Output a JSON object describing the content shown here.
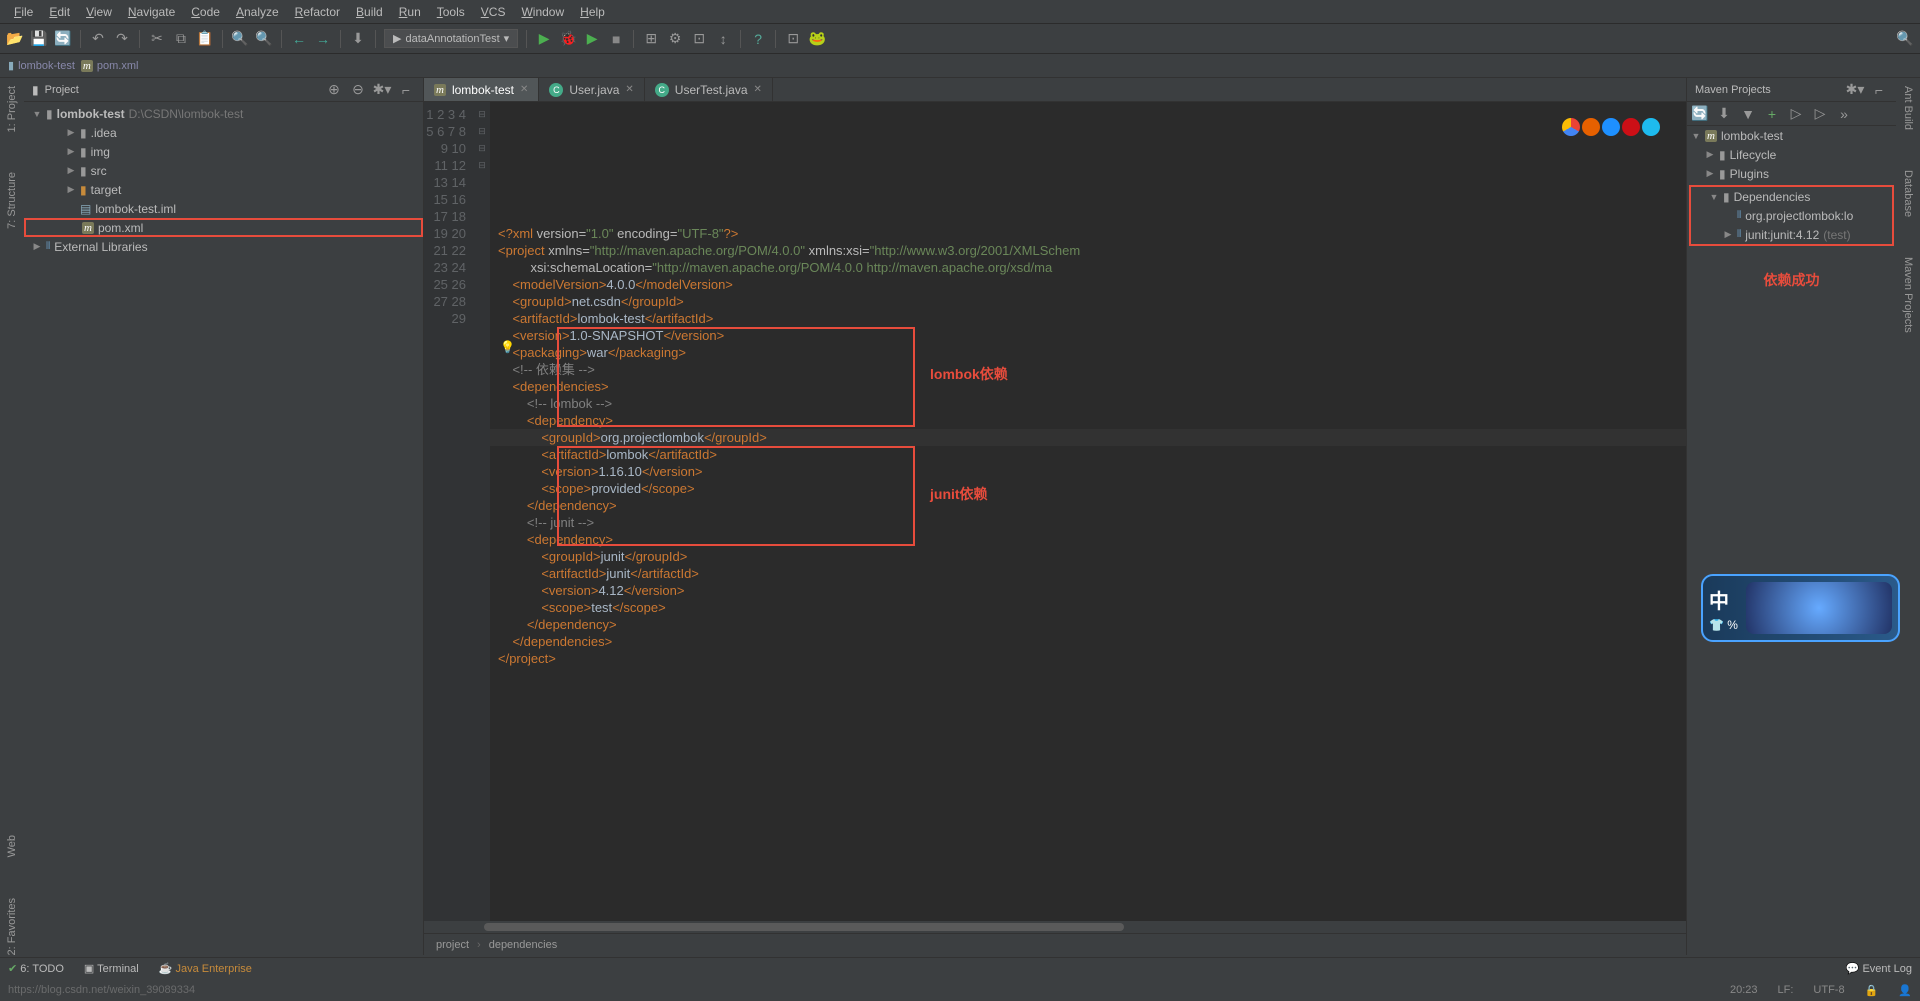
{
  "menu": [
    "File",
    "Edit",
    "View",
    "Navigate",
    "Code",
    "Analyze",
    "Refactor",
    "Build",
    "Run",
    "Tools",
    "VCS",
    "Window",
    "Help"
  ],
  "runConfig": "dataAnnotationTest",
  "nav": {
    "project": "lombok-test",
    "file": "pom.xml"
  },
  "projectPanel": {
    "title": "Project",
    "root": "lombok-test",
    "rootPath": "D:\\CSDN\\lombok-test",
    "folders": [
      ".idea",
      "img",
      "src",
      "target"
    ],
    "files": [
      "lombok-test.iml",
      "pom.xml"
    ],
    "extLib": "External Libraries"
  },
  "tabs": [
    {
      "name": "lombok-test",
      "icon": "m",
      "active": true
    },
    {
      "name": "User.java",
      "icon": "c",
      "active": false
    },
    {
      "name": "UserTest.java",
      "icon": "c",
      "active": false
    }
  ],
  "code": {
    "lines": 29,
    "content": [
      {
        "n": 1,
        "html": "<span class='tag'>&lt;?xml</span> <span class='attr'>version=</span><span class='str'>\"1.0\"</span> <span class='attr'>encoding=</span><span class='str'>\"UTF-8\"</span><span class='tag'>?&gt;</span>"
      },
      {
        "n": 2,
        "html": ""
      },
      {
        "n": 3,
        "html": "<span class='tag'>&lt;project</span> <span class='attr'>xmlns=</span><span class='str'>\"http://maven.apache.org/POM/4.0.0\"</span> <span class='attr'>xmlns:xsi=</span><span class='str'>\"http://www.w3.org/2001/XMLSchem</span>"
      },
      {
        "n": 4,
        "html": "         <span class='attr'>xsi:schemaLocation=</span><span class='str'>\"http://maven.apache.org/POM/4.0.0 http://maven.apache.org/xsd/ma</span>"
      },
      {
        "n": 5,
        "html": "    <span class='tag'>&lt;modelVersion&gt;</span><span class='txt'>4.0.0</span><span class='tag'>&lt;/modelVersion&gt;</span>"
      },
      {
        "n": 6,
        "html": "    <span class='tag'>&lt;groupId&gt;</span><span class='txt'>net.csdn</span><span class='tag'>&lt;/groupId&gt;</span>"
      },
      {
        "n": 7,
        "html": "    <span class='tag'>&lt;artifactId&gt;</span><span class='txt'>lombok-test</span><span class='tag'>&lt;/artifactId&gt;</span>"
      },
      {
        "n": 8,
        "html": "    <span class='tag'>&lt;version&gt;</span><span class='txt'>1.0-SNAPSHOT</span><span class='tag'>&lt;/version&gt;</span>"
      },
      {
        "n": 9,
        "html": "    <span class='tag'>&lt;packaging&gt;</span><span class='txt'>war</span><span class='tag'>&lt;/packaging&gt;</span>"
      },
      {
        "n": 10,
        "html": ""
      },
      {
        "n": 11,
        "html": "    <span class='com'>&lt;!-- 依赖集 --&gt;</span>"
      },
      {
        "n": 12,
        "html": "    <span class='tag'>&lt;dependencies&gt;</span>"
      },
      {
        "n": 13,
        "html": "        <span class='com'>&lt;!-- lombok --&gt;</span>"
      },
      {
        "n": 14,
        "html": "        <span class='tag'>&lt;dependency&gt;</span>"
      },
      {
        "n": 15,
        "html": "            <span class='tag'>&lt;groupId&gt;</span><span class='txt'>org.projectlombok</span><span class='tag'>&lt;/groupId&gt;</span>"
      },
      {
        "n": 16,
        "html": "            <span class='tag'>&lt;artifactId&gt;</span><span class='txt'>lombok</span><span class='tag'>&lt;/artifactId&gt;</span>"
      },
      {
        "n": 17,
        "html": "            <span class='tag'>&lt;version&gt;</span><span class='txt'>1.16.10</span><span class='tag'>&lt;/version&gt;</span>"
      },
      {
        "n": 18,
        "html": "            <span class='tag'>&lt;scope&gt;</span><span class='txt'>provided</span><span class='tag'>&lt;/scope&gt;</span>"
      },
      {
        "n": 19,
        "html": "        <span class='tag'>&lt;/dependency&gt;</span>"
      },
      {
        "n": 20,
        "html": "        <span class='com'>&lt;!-- junit --&gt;</span>"
      },
      {
        "n": 21,
        "html": "        <span class='tag'>&lt;dependency&gt;</span>"
      },
      {
        "n": 22,
        "html": "            <span class='tag'>&lt;groupId&gt;</span><span class='txt'>junit</span><span class='tag'>&lt;/groupId&gt;</span>"
      },
      {
        "n": 23,
        "html": "            <span class='tag'>&lt;artifactId&gt;</span><span class='txt'>junit</span><span class='tag'>&lt;/artifactId&gt;</span>"
      },
      {
        "n": 24,
        "html": "            <span class='tag'>&lt;version&gt;</span><span class='txt'>4.12</span><span class='tag'>&lt;/version&gt;</span>"
      },
      {
        "n": 25,
        "html": "            <span class='tag'>&lt;scope&gt;</span><span class='txt'>test</span><span class='tag'>&lt;/scope&gt;</span>"
      },
      {
        "n": 26,
        "html": "        <span class='tag'>&lt;/dependency&gt;</span>"
      },
      {
        "n": 27,
        "html": "    <span class='tag'>&lt;/dependencies&gt;</span>"
      },
      {
        "n": 28,
        "html": "<span class='tag'>&lt;/project&gt;</span>"
      },
      {
        "n": 29,
        "html": ""
      }
    ],
    "activeLine": 20
  },
  "annotations": {
    "lombokLabel": "lombok依赖",
    "junitLabel": "junit依赖",
    "depSuccessLabel": "依赖成功"
  },
  "breadcrumb": [
    "project",
    "dependencies"
  ],
  "mavenPanel": {
    "title": "Maven Projects",
    "project": "lombok-test",
    "lifecycle": "Lifecycle",
    "plugins": "Plugins",
    "dependencies": "Dependencies",
    "deps": [
      {
        "name": "org.projectlombok:lo",
        "scope": ""
      },
      {
        "name": "junit:junit:4.12",
        "scope": "(test)"
      }
    ]
  },
  "leftTabs": [
    "1: Project",
    "7: Structure"
  ],
  "leftTabs2": [
    "Web",
    "2: Favorites"
  ],
  "rightTabs": [
    "Ant Build",
    "Database",
    "Maven Projects"
  ],
  "bottomTabs": {
    "todo": "6: TODO",
    "terminal": "Terminal",
    "javaEE": "Java Enterprise",
    "eventLog": "Event Log"
  },
  "status": {
    "pos": "20:23",
    "sep": "LF:",
    "enc": "UTF-8",
    "watermark": "https://blog.csdn.net/weixin_39089334"
  },
  "floater": "中"
}
